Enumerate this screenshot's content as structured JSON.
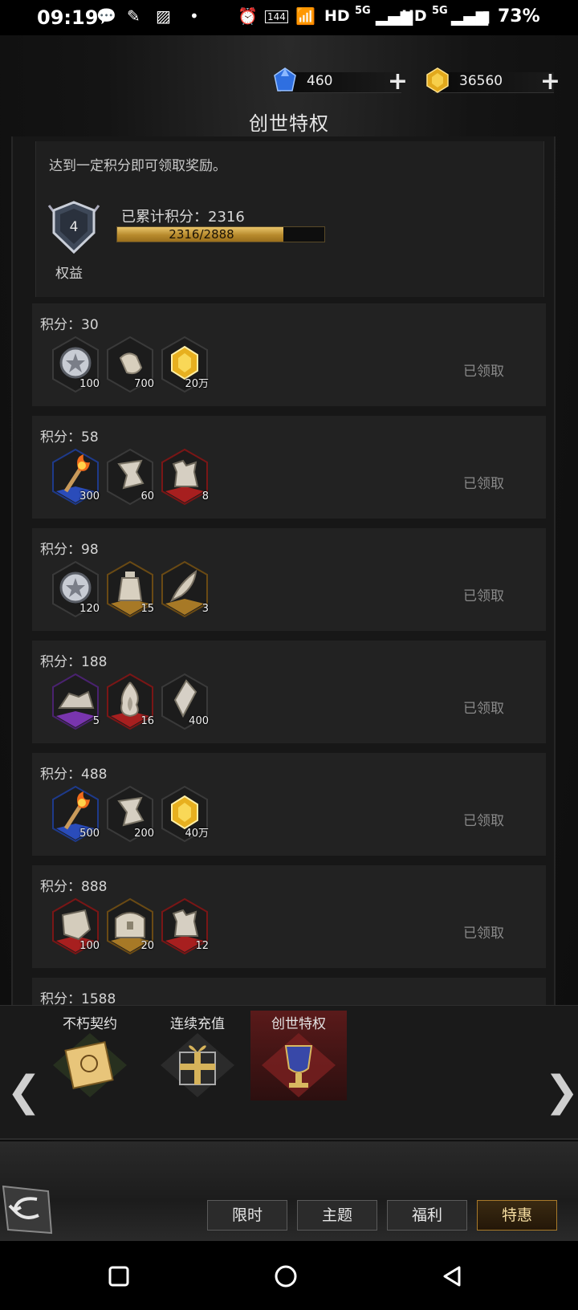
{
  "status": {
    "time": "09:19",
    "battery": "73%",
    "net1": "HD",
    "net2": "5G",
    "net3": "HD",
    "net4": "5G",
    "refresh": "144"
  },
  "currency": {
    "diamond": "460",
    "gold": "36560"
  },
  "title": "创世特权",
  "info": {
    "text": "达到一定积分即可领取奖励。",
    "badge_level": "4",
    "badge_label": "权益",
    "score_label": "已累计积分：2316",
    "progress_text": "2316/2888",
    "progress": 0.802
  },
  "rows": [
    {
      "pts": "积分：30",
      "status": "已领取",
      "items": [
        {
          "icon": "silver-medal-icon",
          "count": "100"
        },
        {
          "icon": "hand-icon",
          "count": "700"
        },
        {
          "icon": "gold-gem-icon",
          "count": "20万"
        }
      ]
    },
    {
      "pts": "积分：58",
      "status": "已领取",
      "items": [
        {
          "icon": "torch-icon",
          "count": "300"
        },
        {
          "icon": "scroll-shard-icon",
          "count": "60"
        },
        {
          "icon": "armor-icon",
          "count": "8"
        }
      ]
    },
    {
      "pts": "积分：98",
      "status": "已领取",
      "items": [
        {
          "icon": "silver-medal-icon",
          "count": "120"
        },
        {
          "icon": "bottle-icon",
          "count": "15"
        },
        {
          "icon": "feather-icon",
          "count": "3"
        }
      ]
    },
    {
      "pts": "积分：188",
      "status": "已领取",
      "items": [
        {
          "icon": "rock-icon",
          "count": "5"
        },
        {
          "icon": "flame-icon",
          "count": "16"
        },
        {
          "icon": "crystal-icon",
          "count": "400"
        }
      ]
    },
    {
      "pts": "积分：488",
      "status": "已领取",
      "items": [
        {
          "icon": "torch-icon",
          "count": "500"
        },
        {
          "icon": "scroll-shard-icon",
          "count": "200"
        },
        {
          "icon": "gold-gem-icon",
          "count": "40万"
        }
      ]
    },
    {
      "pts": "积分：888",
      "status": "已领取",
      "items": [
        {
          "icon": "stone-icon",
          "count": "100"
        },
        {
          "icon": "chest-icon",
          "count": "20"
        },
        {
          "icon": "armor-icon",
          "count": "12"
        }
      ]
    },
    {
      "pts": "积分：1588",
      "status": "",
      "items": []
    }
  ],
  "tabs": [
    {
      "label": "不朽契约"
    },
    {
      "label": "连续充值"
    },
    {
      "label": "创世特权"
    }
  ],
  "buttons": {
    "b1": "限时",
    "b2": "主题",
    "b3": "福利",
    "b4": "特惠"
  },
  "nav": {
    "left_arrow": "❮",
    "right_arrow": "❯"
  }
}
